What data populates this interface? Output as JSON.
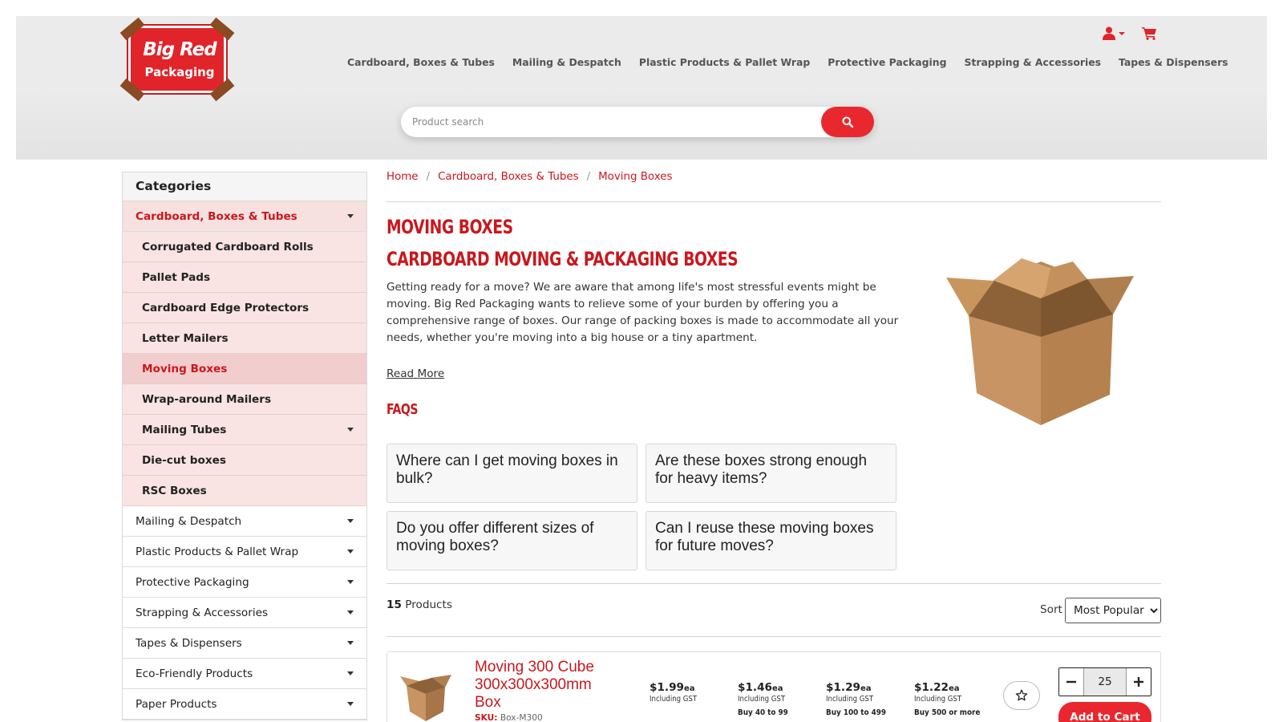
{
  "brand": {
    "line1": "Big Red",
    "line2": "Packaging",
    "red": "#e8282e",
    "dark_red": "#c8181e"
  },
  "header": {
    "icons": [
      "user-icon",
      "chevron-down-icon",
      "cart-icon"
    ],
    "nav": [
      "Cardboard, Boxes & Tubes",
      "Mailing & Despatch",
      "Plastic Products & Pallet Wrap",
      "Protective Packaging",
      "Strapping & Accessories",
      "Tapes & Dispensers"
    ],
    "search": {
      "placeholder": "Product search",
      "value": ""
    }
  },
  "sidebar": {
    "title": "Categories",
    "items": [
      {
        "label": "Cardboard, Boxes & Tubes",
        "level": 1,
        "state": "active",
        "caret": true
      },
      {
        "label": "Corrugated Cardboard Rolls",
        "level": 2
      },
      {
        "label": "Pallet Pads",
        "level": 2
      },
      {
        "label": "Cardboard Edge Protectors",
        "level": 2
      },
      {
        "label": "Letter Mailers",
        "level": 2
      },
      {
        "label": "Moving Boxes",
        "level": 2,
        "state": "current"
      },
      {
        "label": "Wrap-around Mailers",
        "level": 2
      },
      {
        "label": "Mailing Tubes",
        "level": 2,
        "caret": true
      },
      {
        "label": "Die-cut boxes",
        "level": 2
      },
      {
        "label": "RSC Boxes",
        "level": 2
      },
      {
        "label": "Mailing & Despatch",
        "level": 1,
        "caret": true
      },
      {
        "label": "Plastic Products & Pallet Wrap",
        "level": 1,
        "caret": true
      },
      {
        "label": "Protective Packaging",
        "level": 1,
        "caret": true
      },
      {
        "label": "Strapping & Accessories",
        "level": 1,
        "caret": true
      },
      {
        "label": "Tapes & Dispensers",
        "level": 1,
        "caret": true
      },
      {
        "label": "Eco-Friendly Products",
        "level": 1,
        "caret": true
      },
      {
        "label": "Paper Products",
        "level": 1,
        "caret": true
      }
    ]
  },
  "breadcrumb": [
    "Home",
    "Cardboard, Boxes & Tubes",
    "Moving Boxes"
  ],
  "main": {
    "title": "Moving Boxes",
    "subtitle": "Cardboard Moving & Packaging Boxes",
    "intro": "Getting ready for a move? We are aware that among life's most stressful events might be moving. Big Red Packaging wants to relieve some of your burden by offering you a comprehensive range of boxes. Our range of packing boxes is made to accommodate all your needs, whether you're moving into a big house or a tiny apartment.",
    "read_more": "Read More",
    "faqs_title": "FAQs",
    "faqs": [
      "Where can I get moving boxes in bulk?",
      "Are these boxes strong enough for heavy items?",
      "Do you offer different sizes of moving boxes?",
      "Can I reuse these moving boxes for future moves?"
    ]
  },
  "listing": {
    "count": "15",
    "count_label": "Products",
    "sort_label": "Sort",
    "sort_selected": "Most Popular"
  },
  "product": {
    "name": "Moving 300 Cube 300x300x300mm Box",
    "sku_label": "SKU:",
    "sku": "Box-M300",
    "prices": [
      {
        "price": "$1.99",
        "unit": "ea",
        "gst": "Including GST",
        "tier": ""
      },
      {
        "price": "$1.46",
        "unit": "ea",
        "gst": "Including GST",
        "tier": "Buy 40 to 99"
      },
      {
        "price": "$1.29",
        "unit": "ea",
        "gst": "Including GST",
        "tier": "Buy 100 to 499"
      },
      {
        "price": "$1.22",
        "unit": "ea",
        "gst": "Including GST",
        "tier": "Buy 500 or more"
      }
    ],
    "quantity": "25",
    "add_to_cart": "Add to Cart"
  }
}
